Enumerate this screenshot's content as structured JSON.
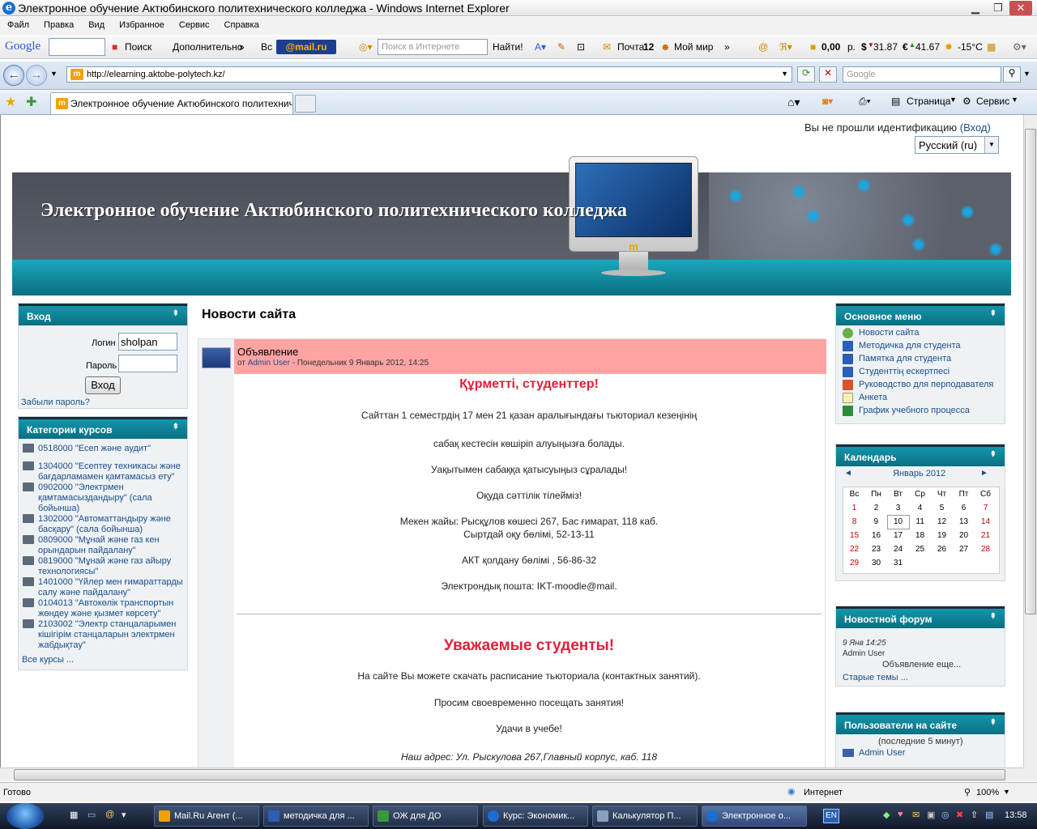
{
  "window": {
    "title": "Электронное обучение Актюбинского политехнического колледжа - Windows Internet Explorer"
  },
  "menu": [
    "Файл",
    "Правка",
    "Вид",
    "Избранное",
    "Сервис",
    "Справка"
  ],
  "toolbar": {
    "google": "Google",
    "search": "Поиск",
    "more": "Дополнительно",
    "more_arrow": "»",
    "vs": "Вс",
    "mailru": "@mail.ru",
    "inet_placeholder": "Поиск в Интернете",
    "find": "Найти!",
    "mail": "Почта",
    "mail_count": "12",
    "myworld": "Мой мир",
    "chevrons": "»",
    "money": "0,00",
    "money_unit": "р.",
    "usd": "31.87",
    "eur": "41.67",
    "temp": "-15°C"
  },
  "address": {
    "url": "http://elearning.aktobe-polytech.kz/",
    "google_placeholder": "Google"
  },
  "tab": {
    "label": "Электронное обучение Актюбинского политехнич..."
  },
  "cmd": {
    "page": "Страница",
    "service": "Сервис"
  },
  "page": {
    "login_info": "Вы не прошли идентификацию",
    "login_link": "(Вход)",
    "lang": "Русский (ru)",
    "banner_title": "Электронное обучение Актюбинского политехнического колледжа",
    "monitor_logo": "m",
    "login_block": {
      "title": "Вход",
      "arrow": "⇞",
      "login_label": "Логин",
      "login_value": "sholpan",
      "pass_label": "Пароль",
      "submit": "Вход",
      "forgot": "Забыли пароль?"
    },
    "cat_block": {
      "title": "Категории курсов",
      "items": [
        "0518000 \"Есеп және аудит\"",
        "1304000 \"Есептеу техникасы және бағдарламамен қамтамасыз ету\"",
        "0902000 \"Электрмен қамтамасыздандыру\" (сала бойынша)",
        "1302000 \"Автоматтандыру және басқару\" (сала бойынша)",
        "0809000 \"Мұнай және газ кен орындарын пайдалану\"",
        "0819000 \"Мұнай және газ айыру технологиясы\"",
        "1401000 \"Үйлер мен ғимараттарды салу және пайдалану\"",
        "0104013 \"Автокөлік транспортын жөндеу және қызмет көрсету\"",
        "2103002 \"Электр станцаларымен кішігірім станцаларын электрмен жабдықтау\""
      ],
      "all": "Все курсы ..."
    },
    "news_head": "Новости сайта",
    "post": {
      "subject": "Объявление",
      "by": "от",
      "author": "Admin User",
      "date": "- Понедельник 9 Январь 2012, 14:25",
      "kz_title": "Құрметті, студенттер!",
      "kz_lines": [
        "Сайттан 1 семестрдің 17 мен 21 қазан аралығындағы тьюториал кезеңінің",
        "сабақ кестесін көшіріп алуыңызға болады.",
        "Уақытымен сабаққа қатысуыңыз сұралады!",
        "Оқуда сәттілік тілейміз!",
        "Мекен жайы: Рысқұлов көшесі 267, Бас ғимарат, 118 каб.",
        "Сыртдай оқу бөлімі, 52-13-11",
        "АКТ қолдану бөлімі , 56-86-32",
        "Электрондық пошта: IKT-moodle@mail."
      ],
      "ru_title": "Уважаемые студенты!",
      "ru_lines": [
        "На сайте Вы можете скачать расписание тьюториала (контактных занятий).",
        "Просим своевременно посещать занятия!",
        "Удачи в учебе!",
        "Наш адрес: Ул. Рыскулова 267,Главный корпус, каб. 118"
      ]
    },
    "main_menu": {
      "title": "Основное меню",
      "items": [
        "Новости сайта",
        "Методичка для студента",
        "Памятка для студента",
        "Студенттің ескертпесі",
        "Руководство для перподавателя",
        "Анкета",
        "График учебного процесса"
      ]
    },
    "calendar": {
      "title": "Календарь",
      "month": "Январь 2012",
      "prev": "◄",
      "next": "►",
      "days": [
        "Вс",
        "Пн",
        "Вт",
        "Ср",
        "Чт",
        "Пт",
        "Сб"
      ],
      "weeks": [
        [
          "1",
          "2",
          "3",
          "4",
          "5",
          "6",
          "7"
        ],
        [
          "8",
          "9",
          "10",
          "11",
          "12",
          "13",
          "14"
        ],
        [
          "15",
          "16",
          "17",
          "18",
          "19",
          "20",
          "21"
        ],
        [
          "22",
          "23",
          "24",
          "25",
          "26",
          "27",
          "28"
        ],
        [
          "29",
          "30",
          "31",
          "",
          "",
          "",
          ""
        ]
      ],
      "today": "10"
    },
    "forum": {
      "title": "Новостной форум",
      "date": "9 Янв 14:25",
      "author": "Admin User",
      "post": "Объявление еще...",
      "older": "Старые темы ..."
    },
    "users": {
      "title": "Пользователи на сайте",
      "period": "(последние 5 минут)",
      "user": "Admin User"
    }
  },
  "status": {
    "left": "Готово",
    "zone": "Интернет",
    "zoom": "100%"
  },
  "taskbar": {
    "tasks": [
      "Mail.Ru Агент (...",
      "методичка для ...",
      "ОЖ  для ДО",
      "Курс: Экономик...",
      "Калькулятор П...",
      "Электронное о..."
    ],
    "lang": "EN",
    "time": "13:58"
  }
}
